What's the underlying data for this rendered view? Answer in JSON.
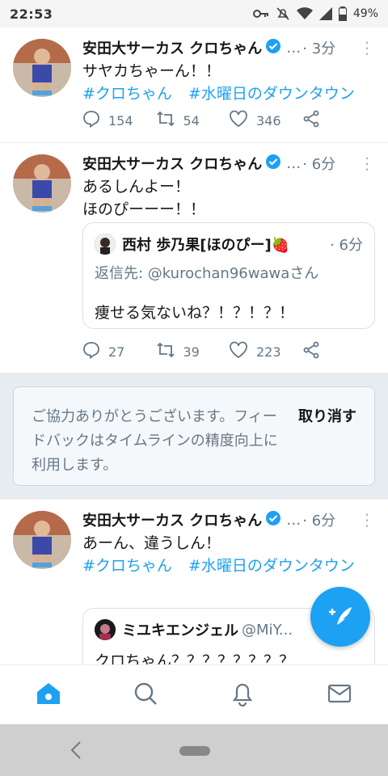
{
  "status_bar": {
    "time": "22:53",
    "battery": "49%"
  },
  "tweets": [
    {
      "name": "安田大サーカス クロちゃん",
      "handle": "…",
      "time": "· 3分",
      "text_lines": [
        "サヤカちゃーん！！"
      ],
      "hashtags": [
        "#クロちゃん",
        "#水曜日のダウンタウン"
      ],
      "replies": "154",
      "retweets": "54",
      "likes": "346"
    },
    {
      "name": "安田大サーカス クロちゃん",
      "handle": "…",
      "time": "· 6分",
      "text_lines": [
        "あるしんよー！",
        "ほのぴーーー！！"
      ],
      "quote": {
        "name": "西村 歩乃果[ほのぴー]🍓",
        "time": "· 6分",
        "reply_to": "返信先: @kurochan96wawaさん",
        "text": "痩せる気ないね？！？！？！"
      },
      "replies": "27",
      "retweets": "39",
      "likes": "223"
    },
    {
      "name": "安田大サーカス クロちゃん",
      "handle": "…",
      "time": "· 6分",
      "text_lines": [
        "あーん、違うしん！"
      ],
      "hashtags": [
        "#クロちゃん",
        "#水曜日のダウンタウン"
      ],
      "quote": {
        "name": "ミユキエンジェル",
        "handle": "@MiY...",
        "text": "クロちゃん？？？？？？？？"
      }
    }
  ],
  "feedback": {
    "text": "ご協力ありがとうございます。フィードバックはタイムラインの精度向上に利用します。",
    "undo_label": "取り消す"
  },
  "colors": {
    "accent": "#1da1f2",
    "secondary_text": "#657786",
    "section_bg": "#e6ecf0"
  },
  "icons": {
    "tabs": [
      "home-icon",
      "search-icon",
      "notifications-icon",
      "messages-icon"
    ],
    "fab": "compose-tweet-icon"
  }
}
